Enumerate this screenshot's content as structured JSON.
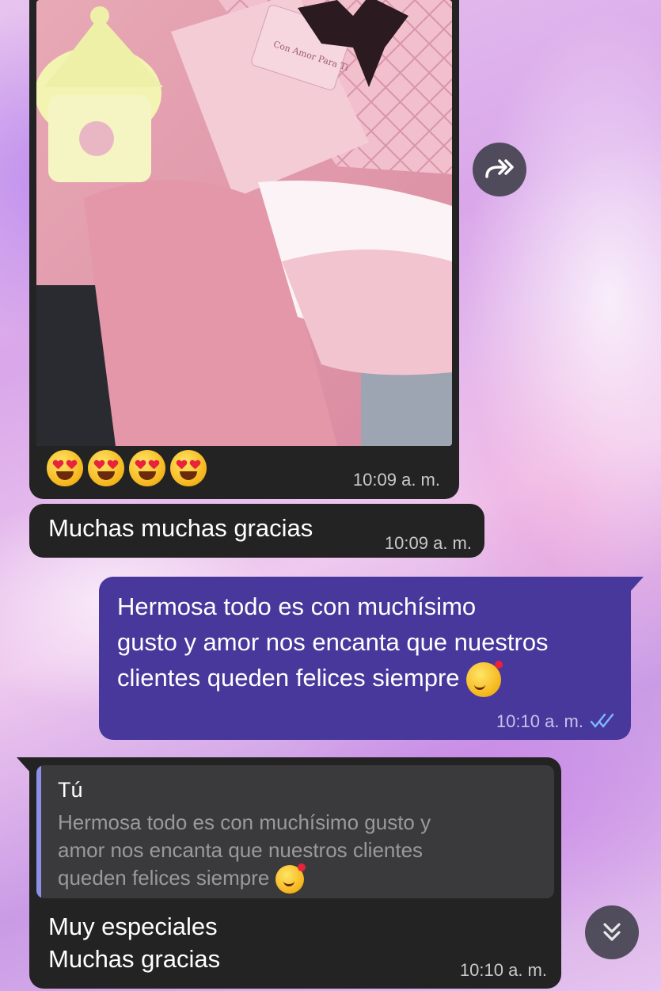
{
  "messages": [
    {
      "type": "photo",
      "caption": "😍😍😍😍",
      "time": "10:09 a. m."
    },
    {
      "type": "text",
      "text": "Muchas muchas gracias",
      "time": "10:09 a. m."
    },
    {
      "type": "outgoing",
      "line1": "Hermosa  todo es con muchísimo",
      "line2": "gusto y amor nos encanta  que nuestros",
      "line3": "clientes queden felices  siempre",
      "emoji": "🥰",
      "time": "10:10 a. m.",
      "status": "read"
    },
    {
      "type": "reply",
      "quote_author": "Tú",
      "quote_line1": "Hermosa  todo es con muchísimo  gusto y",
      "quote_line2": "amor nos encanta  que nuestros clientes",
      "quote_line3": "queden felices  siempre",
      "line1": "Muy especiales",
      "line2": "Muchas gracias",
      "time": "10:10 a. m."
    }
  ],
  "photo_tag_text": "Con Amor Para Ti",
  "colors": {
    "incoming_bubble": "#232324",
    "outgoing_bubble": "#48389c",
    "read_ticks": "#7fb8ff",
    "quote_bar": "#8f8fe8"
  },
  "icons": {
    "forward": "forward-icon",
    "scroll": "double-chevron-down-icon"
  }
}
